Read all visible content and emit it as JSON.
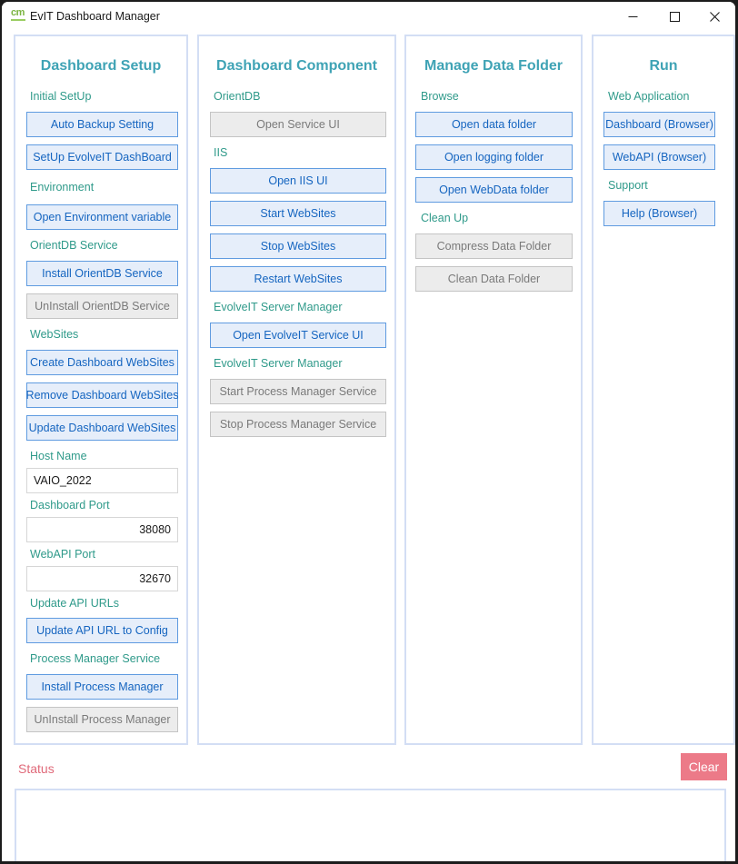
{
  "window": {
    "title": "EvIT Dashboard Manager",
    "icon_text": "cm"
  },
  "colors": {
    "panel_title": "#3fa3b5",
    "section_label": "#2f9a8a",
    "button_text": "#1565c0",
    "button_bg": "#e6eefa",
    "button_border": "#5f9be0",
    "disabled_text": "#7a7a7a",
    "status": "#e06a7a",
    "clear_bg": "#ec7a88"
  },
  "dashboard_setup": {
    "title": "Dashboard Setup",
    "initial_setup_label": "Initial SetUp",
    "auto_backup": "Auto Backup Setting",
    "setup_dashboard": "SetUp EvolveIT DashBoard",
    "environment_label": "Environment",
    "open_env": "Open Environment variable",
    "orientdb_label": "OrientDB Service",
    "install_orientdb": "Install OrientDB Service",
    "uninstall_orientdb": "UnInstall OrientDB Service",
    "websites_label": "WebSites",
    "create_websites": "Create Dashboard WebSites",
    "remove_websites": "Remove Dashboard WebSites",
    "update_websites": "Update Dashboard WebSites",
    "host_name_label": "Host Name",
    "host_name_value": "VAIO_2022",
    "dashboard_port_label": "Dashboard Port",
    "dashboard_port_value": "38080",
    "webapi_port_label": "WebAPI Port",
    "webapi_port_value": "32670",
    "update_api_label": "Update API URLs",
    "update_api_button": "Update API URL to Config",
    "process_manager_label": "Process Manager Service",
    "install_pm": "Install Process Manager",
    "uninstall_pm": "UnInstall Process Manager"
  },
  "dashboard_component": {
    "title": "Dashboard Component",
    "orientdb_label": "OrientDB",
    "open_service_ui": "Open Service UI",
    "iis_label": "IIS",
    "open_iis_ui": "Open IIS UI",
    "start_websites": "Start WebSites",
    "stop_websites": "Stop WebSites",
    "restart_websites": "Restart WebSites",
    "server_manager_label_1": "EvolveIT Server Manager",
    "open_evolveit_ui": "Open EvolveIT Service UI",
    "server_manager_label_2": "EvolveIT Server Manager",
    "start_pm_service": "Start Process Manager Service",
    "stop_pm_service": "Stop Process Manager Service"
  },
  "manage_data_folder": {
    "title": "Manage Data Folder",
    "browse_label": "Browse",
    "open_data_folder": "Open data folder",
    "open_logging_folder": "Open logging folder",
    "open_webdata_folder": "Open WebData folder",
    "cleanup_label": "Clean Up",
    "compress_data_folder": "Compress Data Folder",
    "clean_data_folder": "Clean Data Folder"
  },
  "run": {
    "title": "Run",
    "web_app_label": "Web Application",
    "dashboard_browser": "Dashboard (Browser)",
    "webapi_browser": "WebAPI (Browser)",
    "support_label": "Support",
    "help_browser": "Help (Browser)"
  },
  "status": {
    "label": "Status",
    "clear": "Clear",
    "text": ""
  }
}
